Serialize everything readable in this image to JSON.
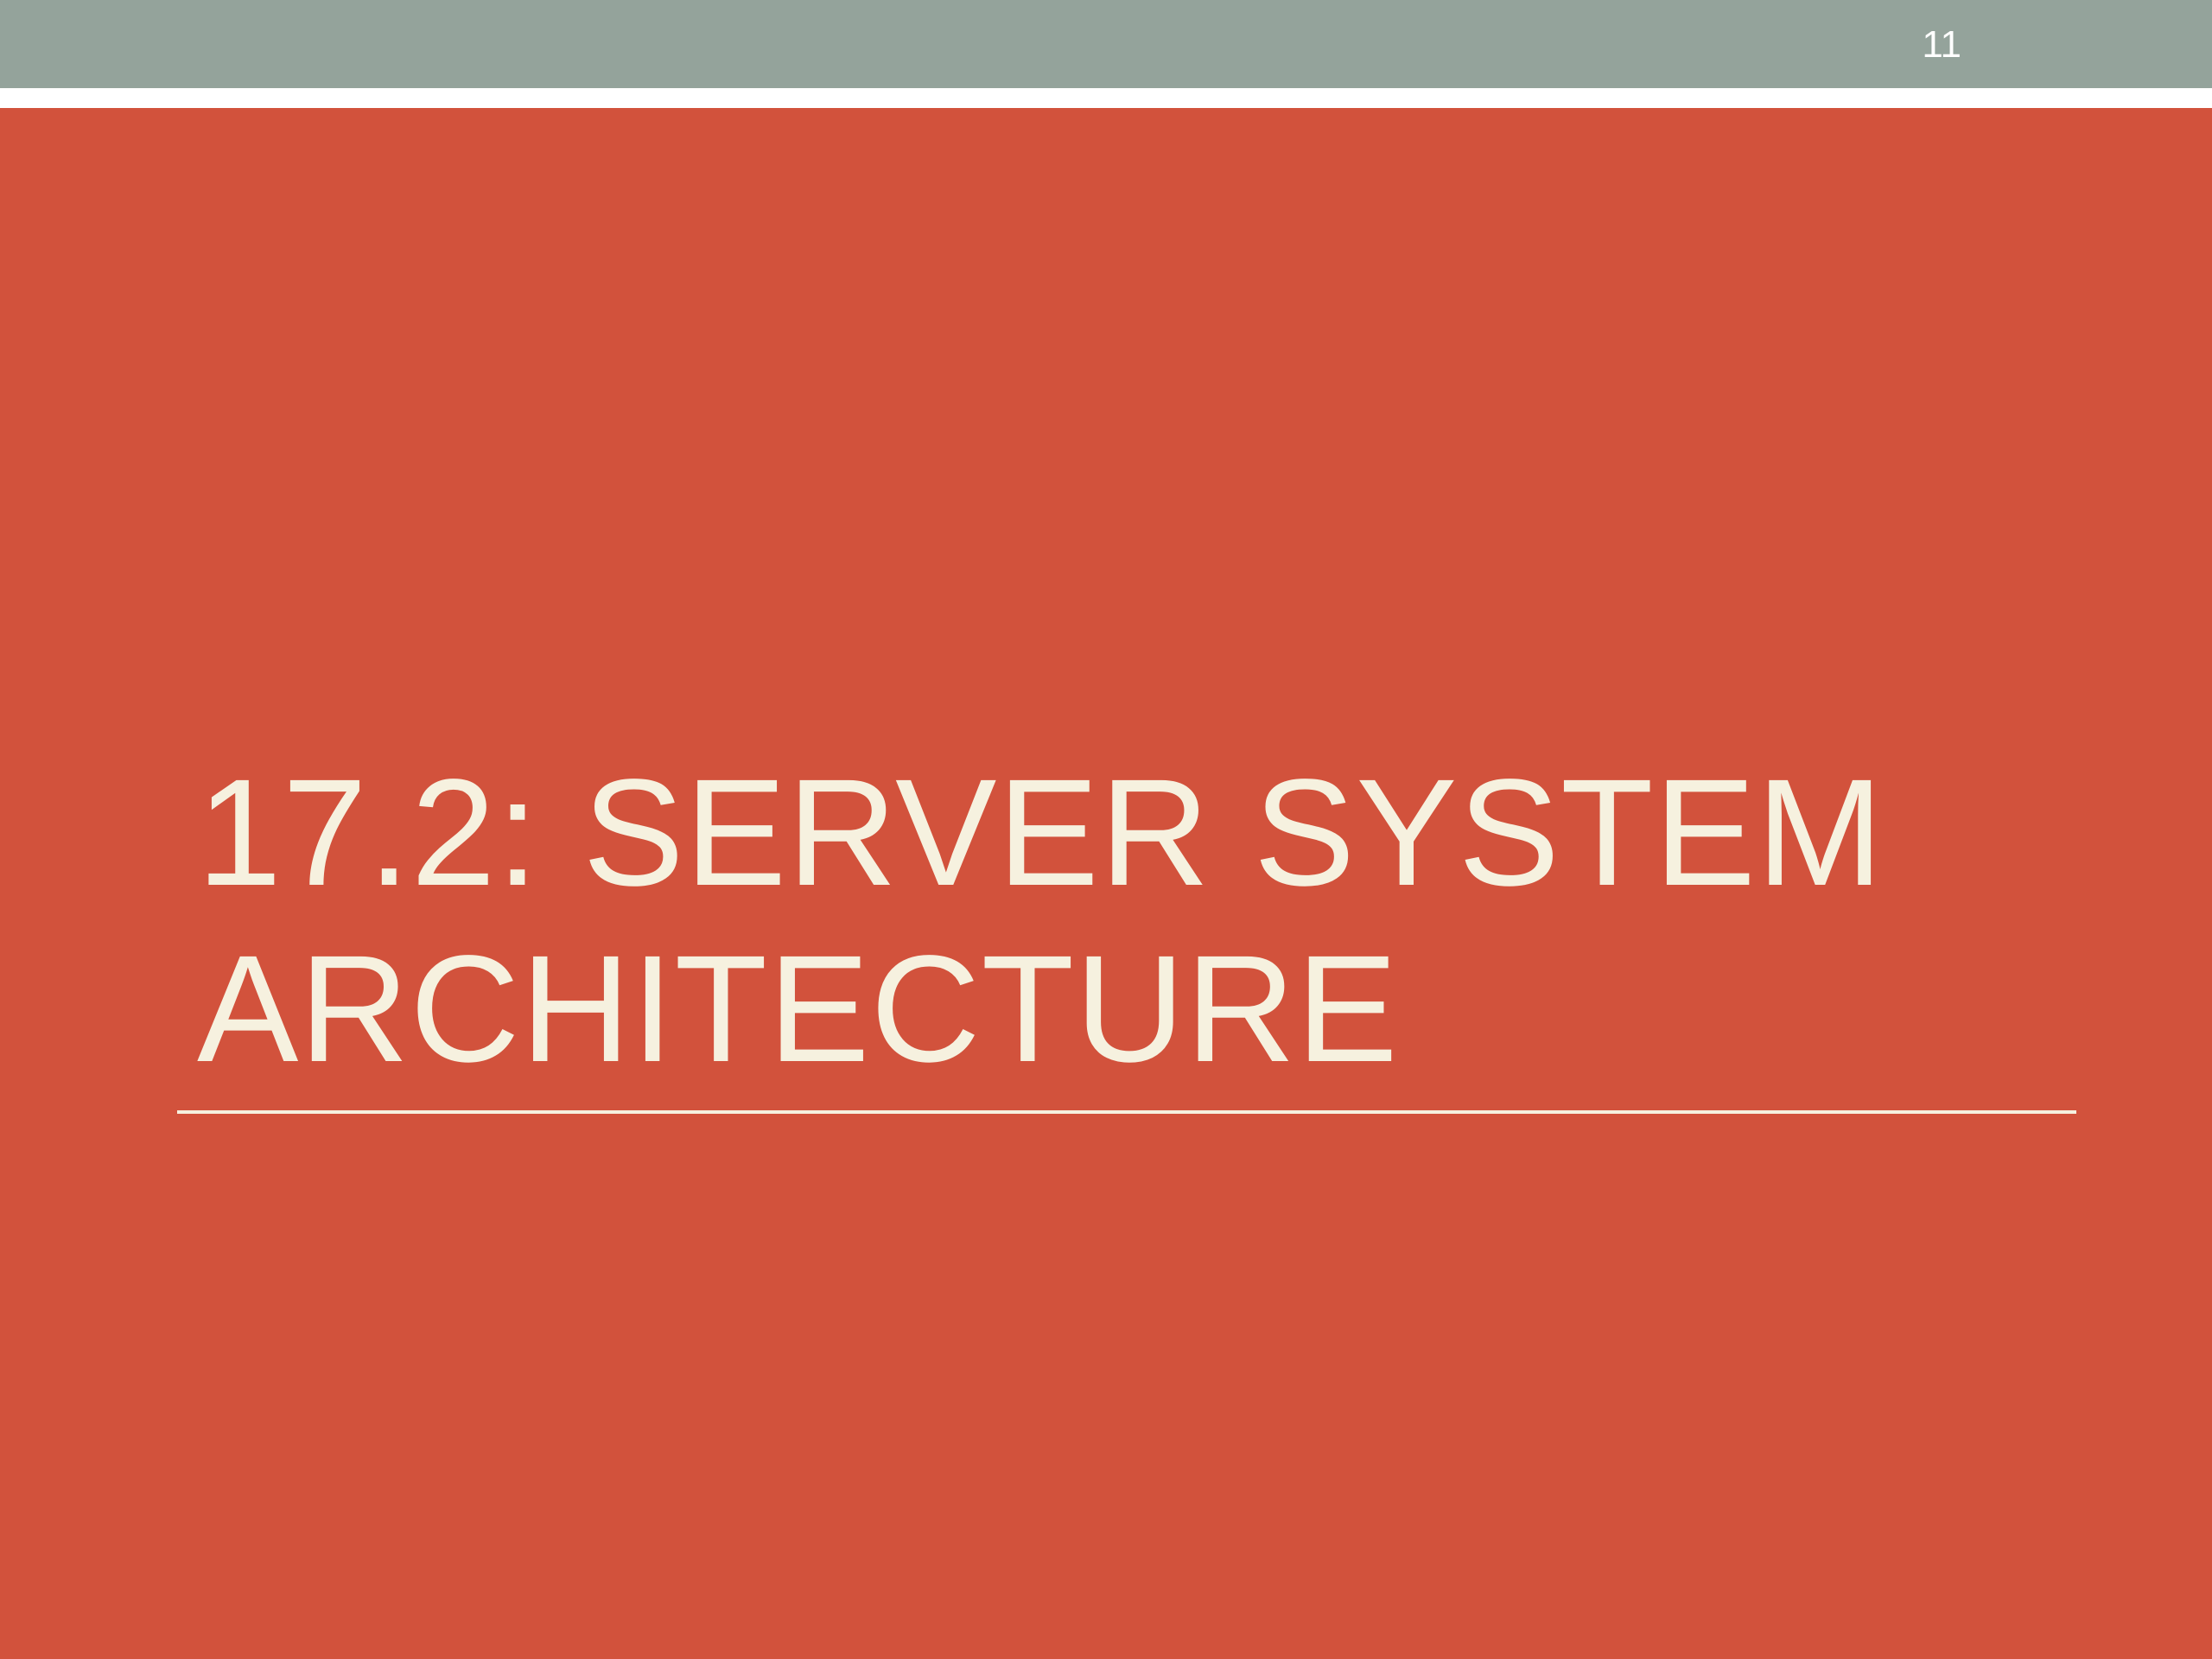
{
  "slide": {
    "number": "11",
    "title_lines": [
      "17.2: SERVER SYSTEM",
      "ARCHITECTURE"
    ]
  },
  "colors": {
    "background": "#D2523C",
    "top_band": "#94A39B",
    "stripe": "#FFFFFF",
    "title_text": "#F6F1DF",
    "slide_number_text": "#FFFFFF"
  }
}
